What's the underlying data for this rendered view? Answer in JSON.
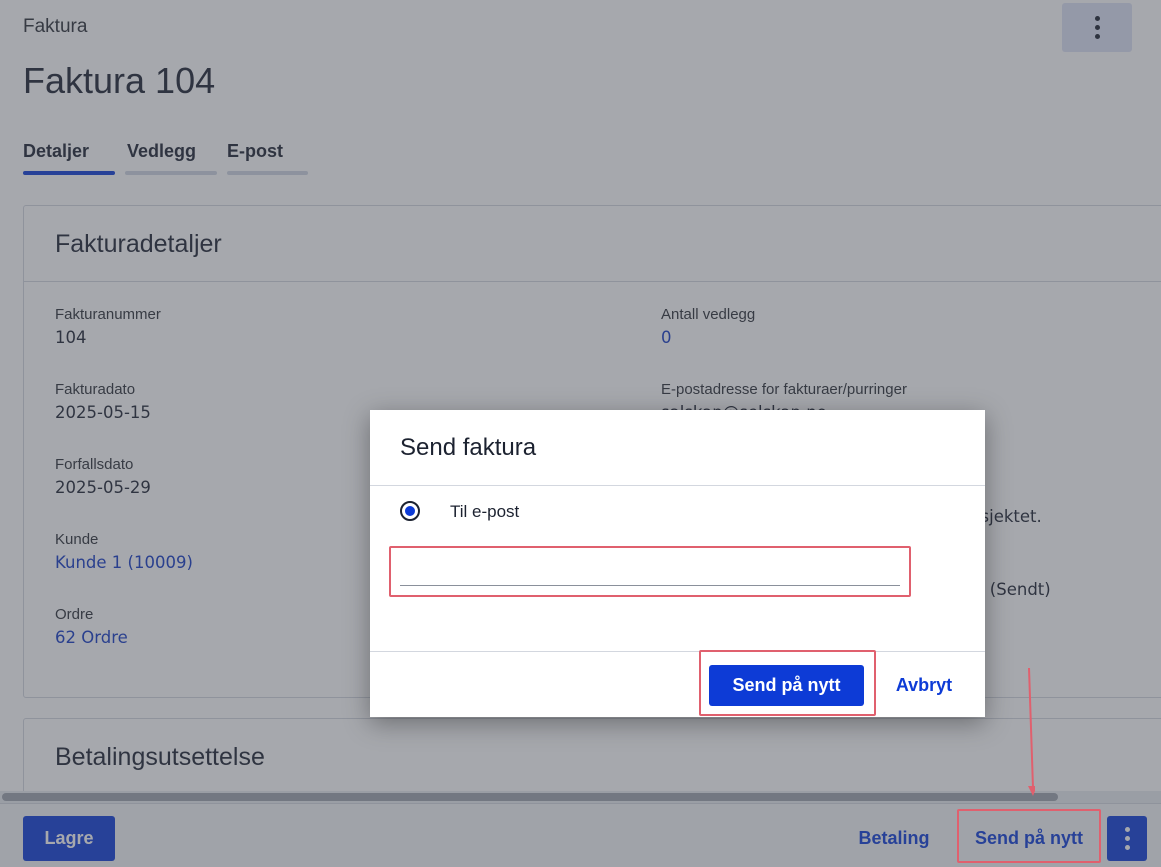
{
  "breadcrumb": "Faktura",
  "page_title": "Faktura 104",
  "tabs": [
    {
      "label": "Detaljer",
      "active": true
    },
    {
      "label": "Vedlegg",
      "active": false
    },
    {
      "label": "E-post",
      "active": false
    }
  ],
  "details_card": {
    "title": "Fakturadetaljer",
    "left_fields": [
      {
        "label": "Fakturanummer",
        "value": "104"
      },
      {
        "label": "Fakturadato",
        "value": "2025-05-15"
      },
      {
        "label": "Forfallsdato",
        "value": "2025-05-29"
      },
      {
        "label": "Kunde",
        "value": "Kunde 1 (10009)"
      },
      {
        "label": "Ordre",
        "value": "62 Ordre"
      }
    ],
    "right_fields": [
      {
        "label": "Antall vedlegg",
        "value": "0"
      },
      {
        "label": "E-postadresse for fakturaer/purringer",
        "value": "salskap@selskap.no"
      }
    ],
    "right_partial_1": "rosjektet.",
    "right_partial_2": "no (Sendt)"
  },
  "card2_title": "Betalingsutsettelse",
  "footer": {
    "save_label": "Lagre",
    "payment_label": "Betaling",
    "resend_label": "Send på nytt"
  },
  "modal": {
    "title": "Send faktura",
    "radio_label": "Til e-post",
    "email_value": "",
    "send_label": "Send på nytt",
    "cancel_label": "Avbryt"
  },
  "colors": {
    "accent": "#0d3bd6",
    "link": "#1339c4",
    "highlight": "#e0606e"
  }
}
